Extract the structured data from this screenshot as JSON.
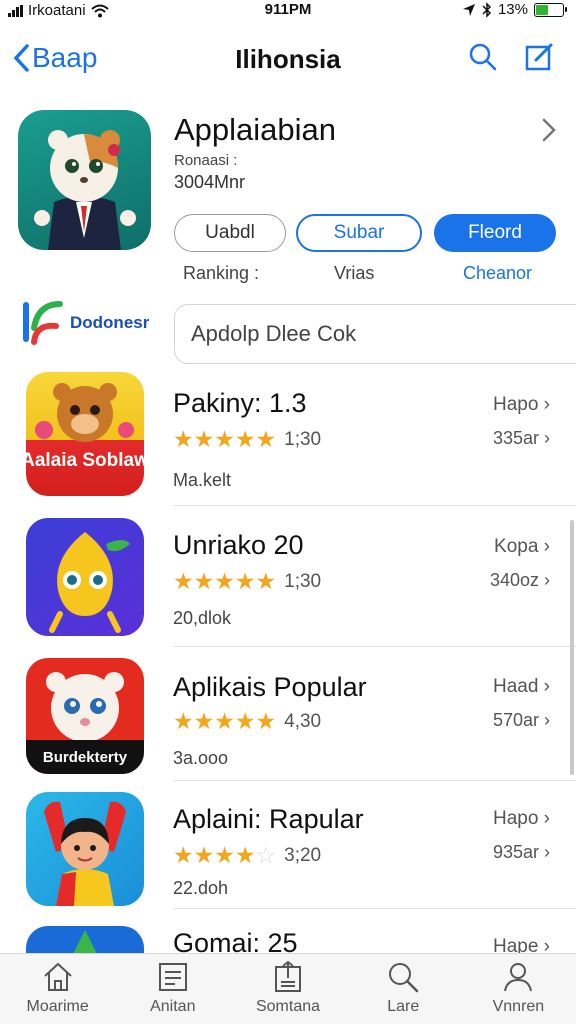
{
  "status_bar": {
    "carrier": "Irkoatani",
    "time": "911PM",
    "battery": "13%"
  },
  "nav": {
    "back_label": "Baap",
    "title": "Ilihonsia",
    "icons": [
      "search-icon",
      "compose-icon"
    ]
  },
  "app": {
    "name": "Applaiabian",
    "sub1": "Ronaasi :",
    "sub2": "3004Mnr",
    "buttons": [
      "Uabdl",
      "Subar",
      "Fleord"
    ],
    "labels": [
      "Ranking :",
      "Vrias",
      "Cheanor"
    ]
  },
  "brand": {
    "name": "Dodonesr"
  },
  "search": {
    "value": "Apdolp Dlee Cok"
  },
  "list": [
    {
      "name": "Pakiny: 1.3",
      "rating": 5,
      "count": "1;30",
      "meta": "Ma.kelt",
      "right1": "Hapo",
      "right2": "335ar",
      "icon_caption": "Aalaia Soblaw"
    },
    {
      "name": "Unriako 20",
      "rating": 5,
      "count": "1;30",
      "meta": "20,dlok",
      "right1": "Kopa",
      "right2": "340oz",
      "icon_caption": ""
    },
    {
      "name": "Aplikais Popular",
      "rating": 5,
      "count": "4,30",
      "meta": "3a.ooo",
      "right1": "Haad",
      "right2": "570ar",
      "icon_caption": "Burdekterty"
    },
    {
      "name": "Aplaini: Rapular",
      "rating": 4.5,
      "count": "3;20",
      "meta": "22.doh",
      "right1": "Hapo",
      "right2": "935ar",
      "icon_caption": ""
    },
    {
      "name": "Gomai: 25",
      "right1": "Hape"
    }
  ],
  "tabs": [
    {
      "label": "Moarime",
      "icon": "home-icon"
    },
    {
      "label": "Anitan",
      "icon": "list-icon"
    },
    {
      "label": "Somtana",
      "icon": "share-icon"
    },
    {
      "label": "Lare",
      "icon": "search-icon"
    },
    {
      "label": "Vnnren",
      "icon": "profile-icon"
    }
  ],
  "colors": {
    "accent": "#1a73e8",
    "star": "#f3a51b"
  }
}
